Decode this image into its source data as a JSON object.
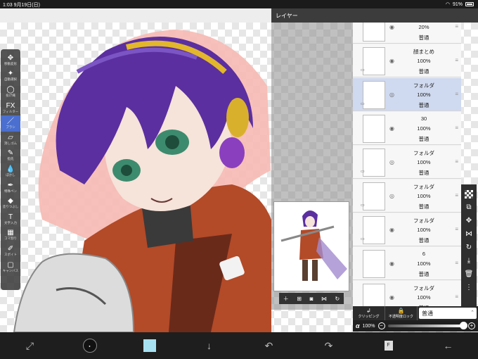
{
  "status": {
    "time": "1:03",
    "date": "9月19日(日)",
    "battery": "91%"
  },
  "toolbar": {
    "tools": [
      {
        "glyph": "✥",
        "label": "移動変形",
        "icon": "move-icon"
      },
      {
        "glyph": "✦",
        "label": "自動選択",
        "icon": "magic-wand-icon"
      },
      {
        "glyph": "◯",
        "label": "投げ縄",
        "icon": "lasso-icon"
      },
      {
        "glyph": "FX",
        "label": "フィルター",
        "icon": "filter-icon"
      },
      {
        "glyph": "／",
        "label": "ブラシ",
        "icon": "brush-icon"
      },
      {
        "glyph": "▱",
        "label": "消しゴム",
        "icon": "eraser-icon"
      },
      {
        "glyph": "✎",
        "label": "指先",
        "icon": "smudge-icon"
      },
      {
        "glyph": "💧",
        "label": "ぼかし",
        "icon": "blur-icon"
      },
      {
        "glyph": "✒",
        "label": "特殊ペン",
        "icon": "special-pen-icon"
      },
      {
        "glyph": "◆",
        "label": "塗りつぶし",
        "icon": "fill-icon"
      },
      {
        "glyph": "T",
        "label": "文字入力",
        "icon": "text-icon"
      },
      {
        "glyph": "▦",
        "label": "コマ割り",
        "icon": "frame-divider-icon"
      },
      {
        "glyph": "✐",
        "label": "スポイト",
        "icon": "eyedropper-icon"
      },
      {
        "glyph": "▢",
        "label": "キャンバス",
        "icon": "canvas-icon"
      }
    ]
  },
  "layer_panel": {
    "title": "レイヤー",
    "layers": [
      {
        "name": "",
        "opacity": "20%",
        "blend": "普通"
      },
      {
        "name": "顔まとめ",
        "opacity": "100%",
        "blend": "普通"
      },
      {
        "name": "フォルダ",
        "opacity": "100%",
        "blend": "普通"
      },
      {
        "name": "30",
        "opacity": "100%",
        "blend": "普通"
      },
      {
        "name": "フォルダ",
        "opacity": "100%",
        "blend": "普通"
      },
      {
        "name": "フォルダ",
        "opacity": "100%",
        "blend": "普通"
      },
      {
        "name": "フォルダ",
        "opacity": "100%",
        "blend": "普通"
      },
      {
        "name": "6",
        "opacity": "100%",
        "blend": "普通"
      },
      {
        "name": "フォルダ",
        "opacity": "100%",
        "blend": "普通"
      }
    ],
    "clipping_label": "クリッピング",
    "lock_label": "不透明度ロック",
    "blend_mode": "普通",
    "opacity_label": "α",
    "opacity_value": "100%"
  },
  "accent_color": "#a7e2f3",
  "selected_layer_color": "#cfd9ef"
}
